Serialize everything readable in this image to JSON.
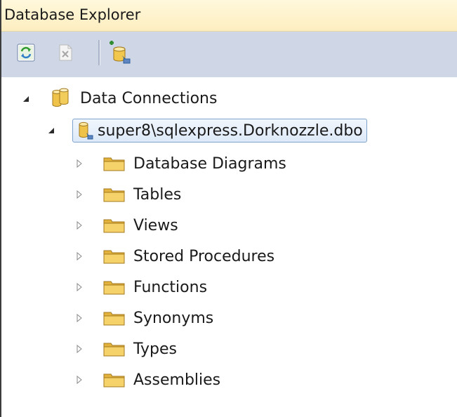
{
  "window": {
    "title": "Database Explorer"
  },
  "toolbar": {
    "buttons": [
      {
        "icon": "refresh-icon"
      },
      {
        "icon": "delete-icon"
      },
      {
        "icon": "connect-to-database-icon"
      }
    ]
  },
  "tree": {
    "root": {
      "label": "Data Connections",
      "expanded": true,
      "icon": "database-icon"
    },
    "connection": {
      "label": "super8\\sqlexpress.Dorknozzle.dbo",
      "expanded": true,
      "selected": true,
      "icon": "database-connection-icon"
    },
    "folders": [
      {
        "label": "Database Diagrams",
        "expanded": false
      },
      {
        "label": "Tables",
        "expanded": false
      },
      {
        "label": "Views",
        "expanded": false
      },
      {
        "label": "Stored Procedures",
        "expanded": false
      },
      {
        "label": "Functions",
        "expanded": false
      },
      {
        "label": "Synonyms",
        "expanded": false
      },
      {
        "label": "Types",
        "expanded": false
      },
      {
        "label": "Assemblies",
        "expanded": false
      }
    ]
  },
  "colors": {
    "title_bg": "#fdeec0",
    "toolbar_bg": "#cfd6e5",
    "selection_border": "#7da2ce",
    "folder_yellow": "#f6d36a"
  }
}
